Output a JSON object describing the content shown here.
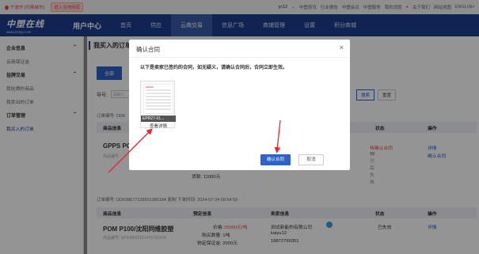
{
  "topbar": {
    "location": "宁波市 [切换城市]",
    "enter": "进入当地频道",
    "user": "yc12",
    "links": [
      "中塑资讯",
      "行业报告",
      "中塑会议",
      "中塑服务",
      "我的消息",
      "关于我们",
      "网站地图",
      "ENGLISH"
    ]
  },
  "header": {
    "logo_text": "中塑在线",
    "logo_sub": "www.21tsp.com",
    "user_center": "用户中心",
    "nav": [
      "首页",
      "供应",
      "云商交易",
      "信息广场",
      "商铺管理",
      "设置",
      "积分商城"
    ],
    "nav_active": 2
  },
  "sidebar": {
    "groups": [
      {
        "label": "企业信息",
        "items": [
          "云商保证金"
        ]
      },
      {
        "label": "挂牌交易",
        "items": [
          "我挂牌的商品",
          "我卖出的订单"
        ]
      },
      {
        "label": "订单管理",
        "items": [
          "我买入的订单"
        ]
      }
    ]
  },
  "main": {
    "title": "我买入的订单",
    "tabs": [
      "全部"
    ],
    "filter_label": "导号:",
    "filter_placeholder": "请输入",
    "search_btn": "搜索",
    "reset_btn": "重置",
    "order1_no": "订单编号: DD6",
    "columns": [
      "商品信息",
      "",
      "",
      "状态",
      "操作"
    ],
    "order1": {
      "name": "GPPS PG",
      "no": "商品编号",
      "price_partial": "货款: 11000元",
      "status1": "待确认合同",
      "status2": "34分后失效",
      "op1": "详情",
      "op2": "确认合同"
    },
    "order2_no": "订单编号: DD638677128501085184  复制  下单时间: 2024-07-24 09:54:53",
    "columns2": [
      "商品信息",
      "预定信息",
      "卖家信息",
      "状态",
      "操作"
    ],
    "order2": {
      "name": "POM P100/沈阳同维胶塑",
      "no": "商品编号: SP638663151415701504",
      "price_label": "价格:",
      "price": "20000元/吨",
      "qty": "购买数量: 1吨",
      "deposit": "物定保证金: 2000元",
      "seller": "测试新能的有限公司",
      "seller_user": "kaiyu12",
      "seller_phone": "18872766351",
      "status": "已失效",
      "op": "详情"
    }
  },
  "dialog": {
    "title": "确认合同",
    "close": "×",
    "notice": "以下是卖家已签约的合同，如无疑义，请确认合同后，合同立即生效。",
    "doc_caption": "EPR27-01...",
    "view": "查看详情",
    "confirm": "确认合同",
    "cancel": "取消"
  }
}
